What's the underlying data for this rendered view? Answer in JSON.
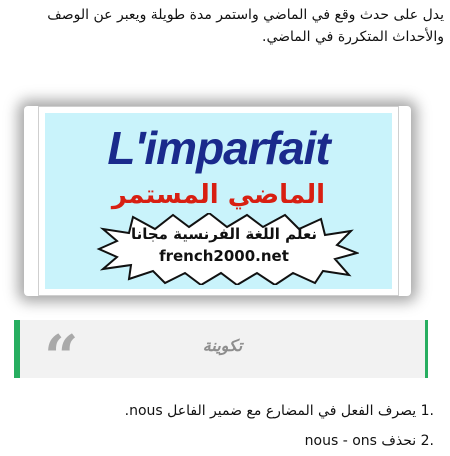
{
  "intro": "يدل على حدث وقع في الماضي واستمر مدة طويلة ويعبر عن الوصف والأحداث المتكررة في الماضي.",
  "banner": {
    "title": "L'imparfait",
    "subtitle": "الماضي المستمر",
    "tagline": "نعلم اللغة الفرنسية مجانا",
    "site": "french2000.net",
    "colors": {
      "background": "#c9f3fb",
      "title": "#1a2a8c",
      "subtitle": "#d81f12"
    }
  },
  "quote": {
    "mark": "“",
    "text": "تكوينة",
    "accent": "#27ae60"
  },
  "steps": [
    {
      "num": "1.",
      "text": "يصرف الفعل في المضارع مع ضمير الفاعل nous."
    },
    {
      "num": "2.",
      "text": "نحذف nous - ons"
    }
  ]
}
